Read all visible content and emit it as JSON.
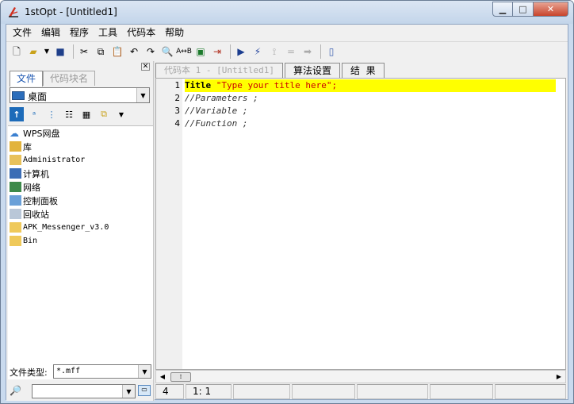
{
  "window": {
    "title": "1stOpt - [Untitled1]"
  },
  "menu": [
    "文件",
    "编辑",
    "程序",
    "工具",
    "代码本",
    "帮助"
  ],
  "toolbar_icons": [
    "new-file-icon",
    "open-folder-icon",
    "dropdown-arrow-icon",
    "save-icon",
    "cut-icon",
    "copy-icon",
    "paste-icon",
    "undo-icon",
    "redo-icon",
    "find-icon",
    "replace-icon",
    "excel-icon",
    "insert-icon",
    "run-icon",
    "wand-icon",
    "step-icon",
    "equals-icon",
    "next-icon",
    "exit-icon"
  ],
  "left_panel": {
    "tabs": [
      "文件",
      "代码块名"
    ],
    "drive": "桌面",
    "items": [
      {
        "name": "WPS网盘",
        "icon": "cloud-icon"
      },
      {
        "name": "库",
        "icon": "library-icon"
      },
      {
        "name": "Administrator",
        "icon": "user-folder-icon"
      },
      {
        "name": "计算机",
        "icon": "computer-icon"
      },
      {
        "name": "网络",
        "icon": "network-icon"
      },
      {
        "name": "控制面板",
        "icon": "control-panel-icon"
      },
      {
        "name": "回收站",
        "icon": "recycle-bin-icon"
      },
      {
        "name": "APK_Messenger_v3.0",
        "icon": "folder-icon"
      },
      {
        "name": "Bin",
        "icon": "folder-icon"
      }
    ],
    "file_type_label": "文件类型:",
    "file_type_value": "*.mff"
  },
  "editor": {
    "tabs": [
      "代码本 1 - [Untitled1]",
      "算法设置",
      "结  果"
    ],
    "lines": [
      {
        "num": "1",
        "kw": "Title",
        "rest": " \"Type your title here\";"
      },
      {
        "num": "2",
        "text": "//Parameters ;"
      },
      {
        "num": "3",
        "text": "//Variable ;"
      },
      {
        "num": "4",
        "text": "//Function ;"
      }
    ]
  },
  "status": {
    "line_count": "4",
    "position": "1: 1"
  }
}
